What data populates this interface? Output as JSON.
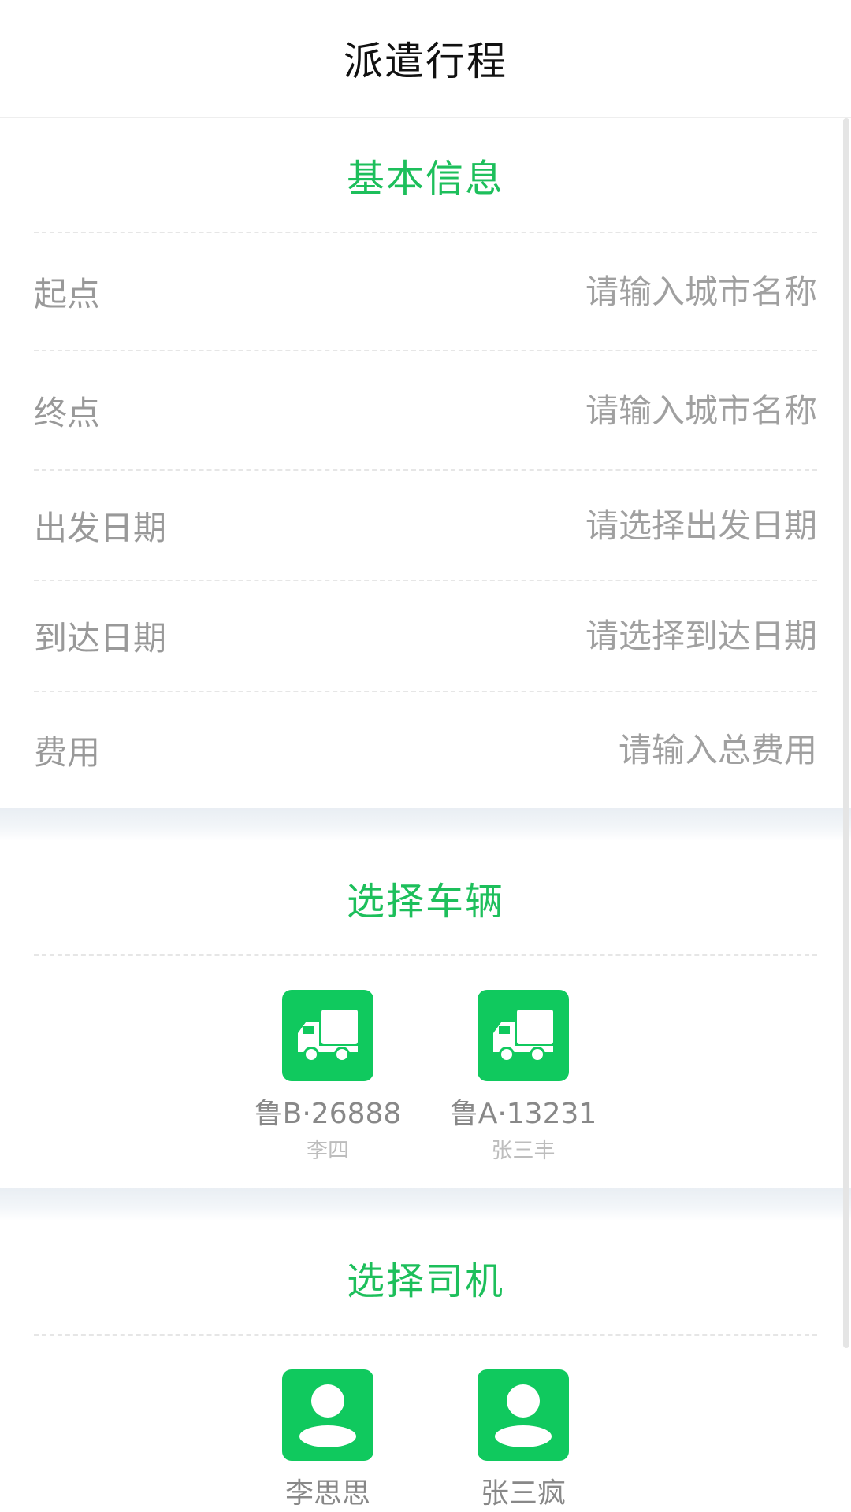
{
  "header": {
    "title": "派遣行程"
  },
  "basic": {
    "title": "基本信息",
    "fields": [
      {
        "label": "起点",
        "placeholder": "请输入城市名称"
      },
      {
        "label": "终点",
        "placeholder": "请输入城市名称"
      },
      {
        "label": "出发日期",
        "placeholder": "请选择出发日期"
      },
      {
        "label": "到达日期",
        "placeholder": "请选择到达日期"
      },
      {
        "label": "费用",
        "placeholder": "请输入总费用"
      }
    ]
  },
  "vehicles": {
    "title": "选择车辆",
    "items": [
      {
        "plate": "鲁B·26888",
        "driver": "李四",
        "icon": "truck-icon"
      },
      {
        "plate": "鲁A·13231",
        "driver": "张三丰",
        "icon": "truck-icon"
      }
    ]
  },
  "drivers": {
    "title": "选择司机",
    "items": [
      {
        "name": "李思思",
        "icon": "person-icon"
      },
      {
        "name": "张三疯",
        "icon": "person-icon"
      }
    ]
  },
  "colors": {
    "accent": "#1dbf5b",
    "icon_bg": "#10c95e"
  }
}
